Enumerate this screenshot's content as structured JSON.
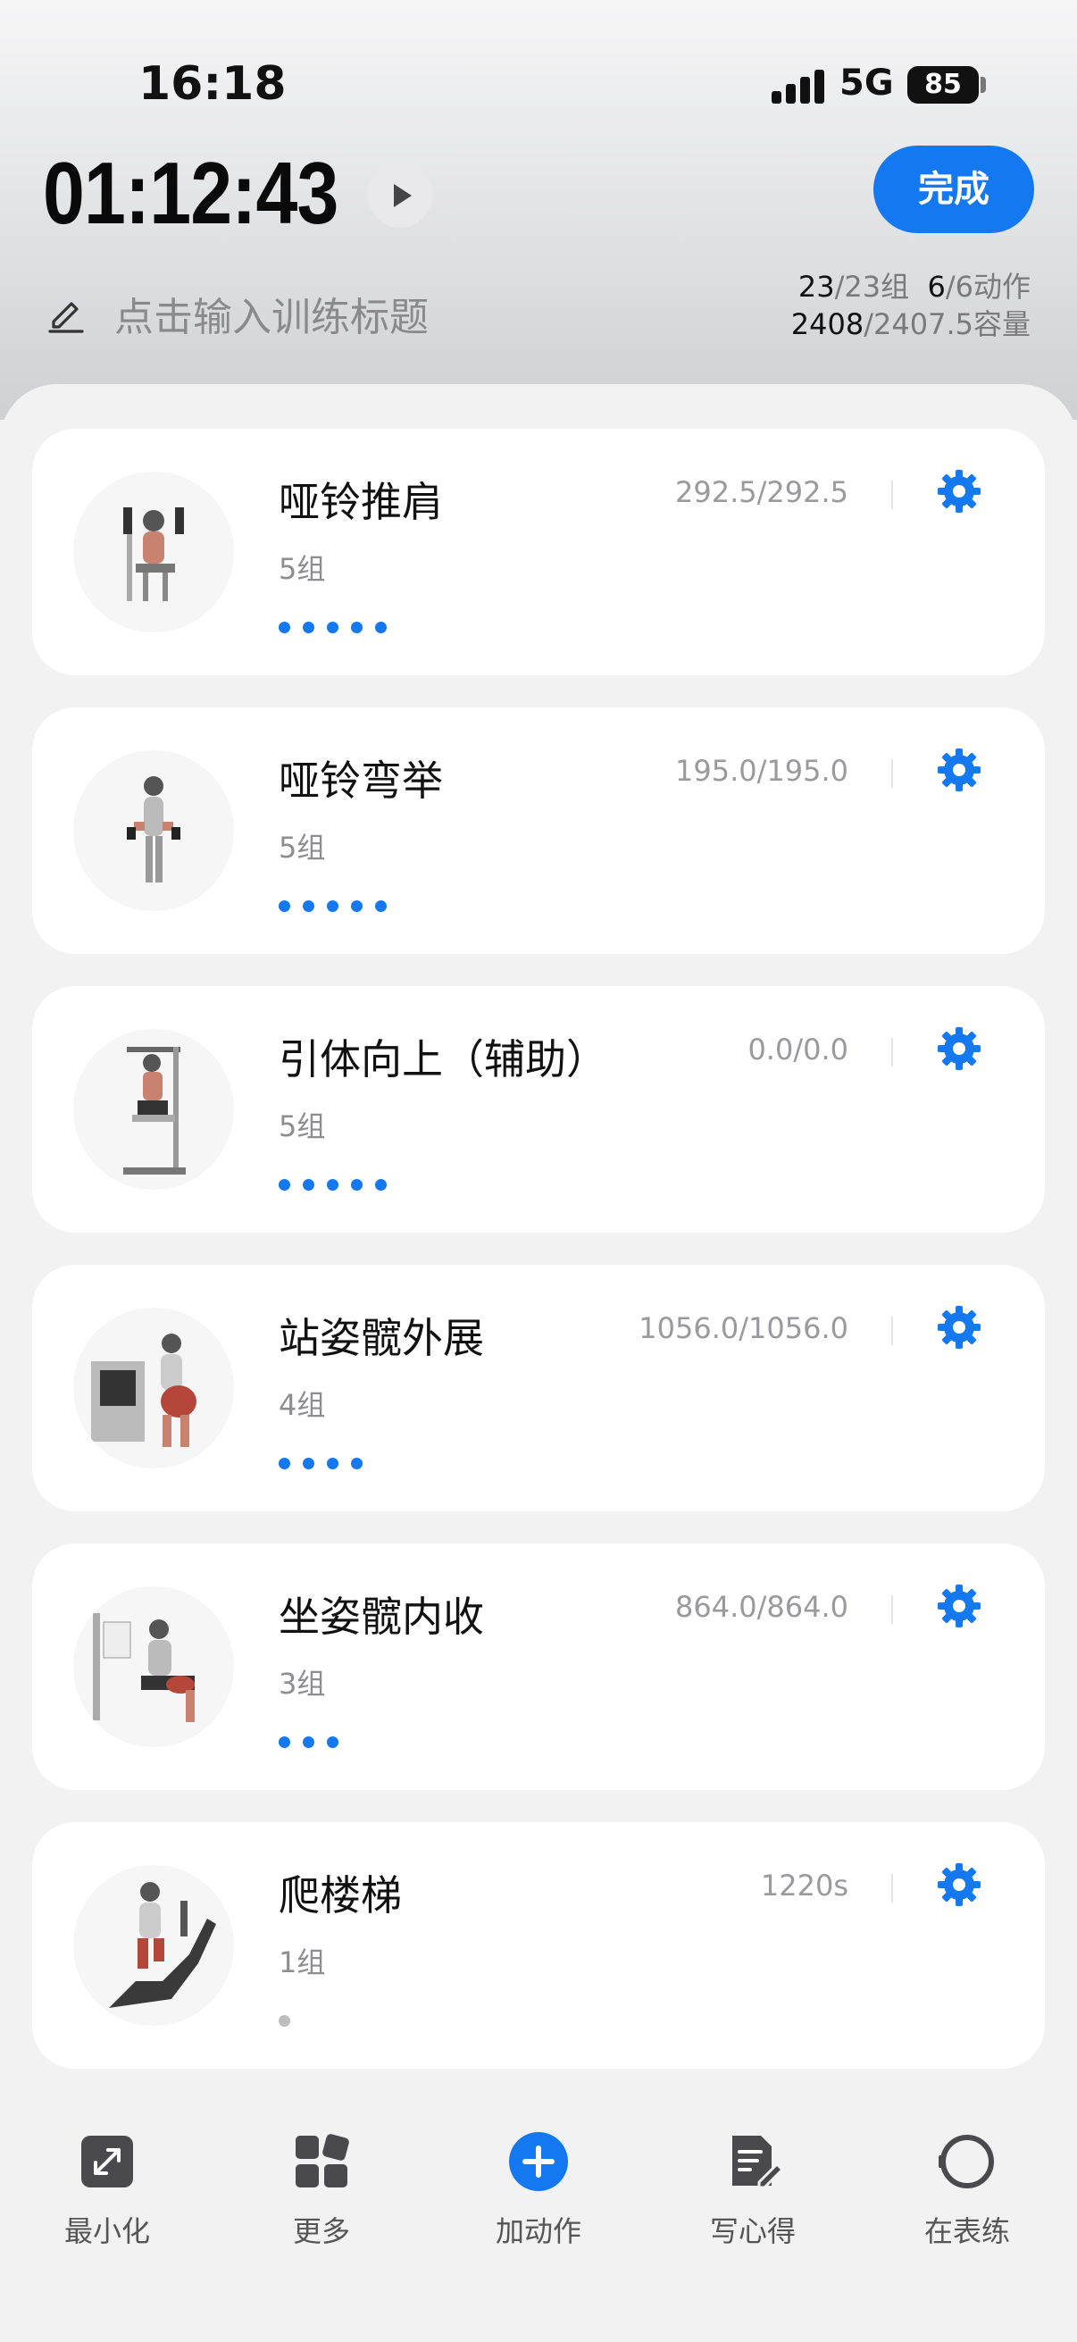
{
  "status": {
    "time": "16:18",
    "network": "5G",
    "battery": "85"
  },
  "header": {
    "timer": "01:12:43",
    "done_label": "完成",
    "title_placeholder": "点击输入训练标题",
    "stats": {
      "sets_done": "23",
      "sets_total": "/23组",
      "actions_done": "6",
      "actions_total": "/6动作",
      "volume_done": "2408",
      "volume_total": "/2407.5容量"
    }
  },
  "exercises": [
    {
      "name": "哑铃推肩",
      "sets": "5组",
      "volume": "292.5/292.5",
      "dots": 5,
      "icon": "shoulder-press-figure"
    },
    {
      "name": "哑铃弯举",
      "sets": "5组",
      "volume": "195.0/195.0",
      "dots": 5,
      "icon": "bicep-curl-figure"
    },
    {
      "name": "引体向上（辅助）",
      "sets": "5组",
      "volume": "0.0/0.0",
      "dots": 5,
      "icon": "assisted-pullup-figure"
    },
    {
      "name": "站姿髋外展",
      "sets": "4组",
      "volume": "1056.0/1056.0",
      "dots": 4,
      "icon": "hip-abduction-figure"
    },
    {
      "name": "坐姿髋内收",
      "sets": "3组",
      "volume": "864.0/864.0",
      "dots": 3,
      "icon": "hip-adduction-figure"
    },
    {
      "name": "爬楼梯",
      "sets": "1组",
      "volume": "1220s",
      "dots": 1,
      "icon": "stair-climber-figure"
    }
  ],
  "bottom_bar": {
    "minimize": "最小化",
    "more": "更多",
    "add": "加动作",
    "notes": "写心得",
    "watch": "在表练"
  },
  "colors": {
    "accent": "#1479f0",
    "dot_inactive": "#bdbdc0"
  }
}
